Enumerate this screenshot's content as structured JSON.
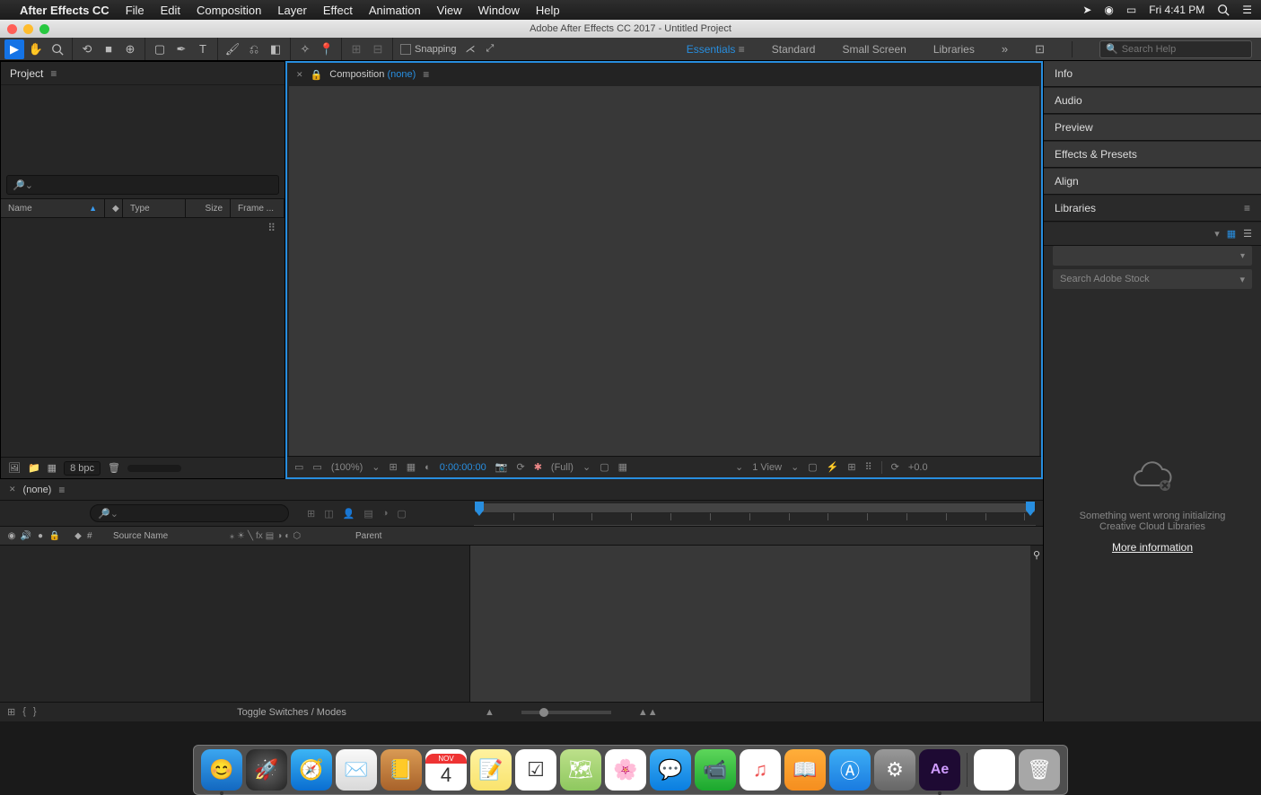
{
  "menubar": {
    "app": "After Effects CC",
    "items": [
      "File",
      "Edit",
      "Composition",
      "Layer",
      "Effect",
      "Animation",
      "View",
      "Window",
      "Help"
    ],
    "clock": "Fri 4:41 PM"
  },
  "window": {
    "title": "Adobe After Effects CC 2017 - Untitled Project"
  },
  "toolbar": {
    "snapping_label": "Snapping",
    "workspaces": {
      "essentials": "Essentials",
      "standard": "Standard",
      "small": "Small Screen",
      "libraries": "Libraries"
    },
    "search_placeholder": "Search Help"
  },
  "project": {
    "title": "Project",
    "columns": {
      "name": "Name",
      "type": "Type",
      "size": "Size",
      "frame": "Frame ..."
    },
    "footer_bpc": "8 bpc"
  },
  "composition": {
    "tab_label": "Composition",
    "none": "(none)",
    "footer": {
      "zoom": "(100%)",
      "time": "0:00:00:00",
      "res": "(Full)",
      "view": "1 View",
      "exposure": "+0.0"
    }
  },
  "right_panels": {
    "info": "Info",
    "audio": "Audio",
    "preview": "Preview",
    "effects": "Effects & Presets",
    "align": "Align",
    "libraries": "Libraries",
    "lib": {
      "search_placeholder": "Search Adobe Stock",
      "error_line1": "Something went wrong initializing",
      "error_line2": "Creative Cloud Libraries",
      "more": "More information"
    }
  },
  "timeline": {
    "title": "(none)",
    "cols": {
      "hash": "#",
      "source": "Source Name",
      "parent": "Parent"
    },
    "toggle": "Toggle Switches / Modes"
  },
  "dock": {
    "cal_month": "NOV",
    "cal_day": "4",
    "ae_label": "Ae"
  }
}
